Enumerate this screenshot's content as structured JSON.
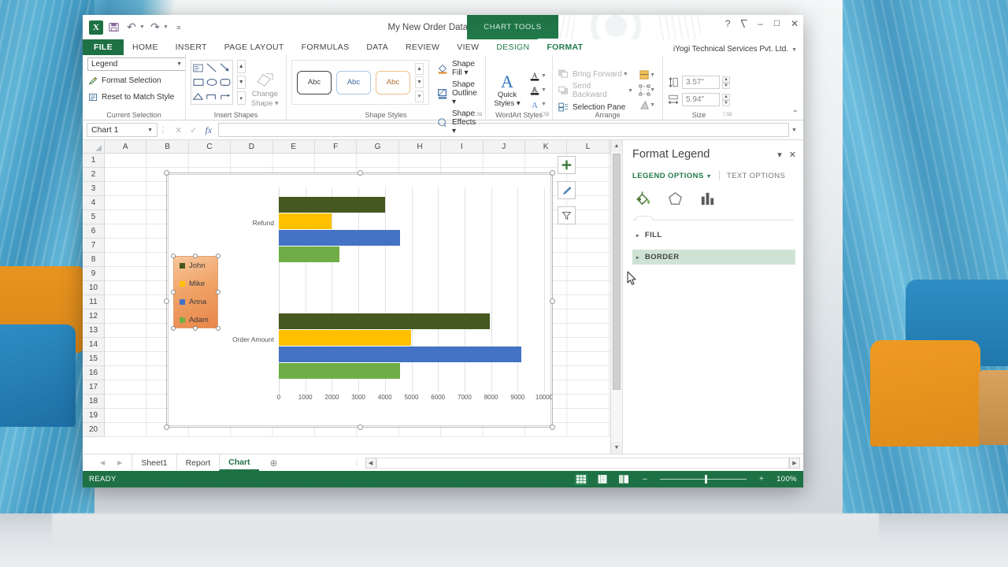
{
  "window": {
    "title": "My New Order Data - Excel",
    "contextual_tab_group": "CHART TOOLS",
    "account": "iYogi Technical Services Pvt. Ltd.",
    "help_icon": "?",
    "ribbon_display_icon": "ribbon-display-options",
    "minimize_icon": "–",
    "restore_icon": "❐",
    "close_icon": "✕",
    "logo_text": "X"
  },
  "quick_access": [
    {
      "name": "save-icon",
      "glyph": "ὋE"
    },
    {
      "name": "undo-icon",
      "glyph": "↶"
    },
    {
      "name": "redo-icon",
      "glyph": "↷"
    },
    {
      "name": "customize-qat-icon",
      "glyph": "≡"
    }
  ],
  "tabs": [
    {
      "label": "FILE",
      "kind": "file"
    },
    {
      "label": "HOME",
      "kind": "normal"
    },
    {
      "label": "INSERT",
      "kind": "normal"
    },
    {
      "label": "PAGE LAYOUT",
      "kind": "normal"
    },
    {
      "label": "FORMULAS",
      "kind": "normal"
    },
    {
      "label": "DATA",
      "kind": "normal"
    },
    {
      "label": "REVIEW",
      "kind": "normal"
    },
    {
      "label": "VIEW",
      "kind": "normal"
    },
    {
      "label": "DESIGN",
      "kind": "contextual"
    },
    {
      "label": "FORMAT",
      "kind": "contextual-active"
    }
  ],
  "ribbon": {
    "current_selection": {
      "group_label": "Current Selection",
      "combo_value": "Legend",
      "format_selection": "Format Selection",
      "reset_to_match_style": "Reset to Match Style"
    },
    "insert_shapes": {
      "group_label": "Insert Shapes",
      "change_shape_line1": "Change",
      "change_shape_line2": "Shape"
    },
    "shape_styles": {
      "group_label": "Shape Styles",
      "preview_text": "Abc",
      "shape_fill": "Shape Fill",
      "shape_outline": "Shape Outline",
      "shape_effects": "Shape Effects"
    },
    "wordart_styles": {
      "group_label": "WordArt Styles",
      "quick_line1": "Quick",
      "quick_line2": "Styles"
    },
    "arrange": {
      "group_label": "Arrange",
      "bring_forward": "Bring Forward",
      "send_backward": "Send Backward",
      "selection_pane": "Selection Pane"
    },
    "size": {
      "group_label": "Size",
      "height_value": "3.57\"",
      "width_value": "5.94\""
    },
    "collapse_icon": "⌃"
  },
  "formula_bar": {
    "name_box_value": "Chart 1",
    "cancel_icon": "✕",
    "enter_icon": "✓",
    "fx_icon": "fx",
    "formula_value": ""
  },
  "sheet": {
    "columns": [
      "A",
      "B",
      "C",
      "D",
      "E",
      "F",
      "G",
      "H",
      "I",
      "J",
      "K",
      "L"
    ],
    "rows": [
      1,
      2,
      3,
      4,
      5,
      6,
      7,
      8,
      9,
      10,
      11,
      12,
      13,
      14,
      15,
      16,
      17,
      18,
      19,
      20
    ]
  },
  "chart_buttons": [
    {
      "name": "chart-elements-button",
      "glyph": "✚"
    },
    {
      "name": "chart-styles-button",
      "glyph": "✐"
    },
    {
      "name": "chart-filters-button",
      "glyph": "▽"
    }
  ],
  "chart_data": {
    "type": "bar",
    "title": "",
    "xlabel": "",
    "ylabel": "",
    "categories": [
      "Refund",
      "Order Amount"
    ],
    "series": [
      {
        "name": "John",
        "color": "#44581f",
        "values": [
          4000,
          7950
        ]
      },
      {
        "name": "Mike",
        "color": "#ffc000",
        "values": [
          1980,
          4980
        ]
      },
      {
        "name": "Anna",
        "color": "#4472c4",
        "values": [
          4560,
          9150
        ]
      },
      {
        "name": "Adam",
        "color": "#70ad47",
        "values": [
          2280,
          4570
        ]
      }
    ],
    "xticks": [
      0,
      1000,
      2000,
      3000,
      4000,
      5000,
      6000,
      7000,
      8000,
      9000,
      10000
    ],
    "xlim": [
      0,
      10000
    ],
    "grid": true,
    "legend_position": "left",
    "legend_selected": true,
    "legend_fill": "orange-gradient",
    "orientation": "horizontal"
  },
  "pane": {
    "title": "Format Legend",
    "dropdown_icon": "▾",
    "close_icon": "✕",
    "tab_legend_options": "LEGEND OPTIONS",
    "tab_text_options": "TEXT OPTIONS",
    "icons": [
      {
        "name": "fill-and-line-icon"
      },
      {
        "name": "effects-icon"
      },
      {
        "name": "size-and-properties-icon"
      }
    ],
    "sections": [
      {
        "label": "FILL",
        "selected": false
      },
      {
        "label": "BORDER",
        "selected": true
      }
    ]
  },
  "sheet_tabs": {
    "prev_icon": "◀",
    "next_icon": "▶",
    "tabs": [
      {
        "label": "Sheet1",
        "active": false
      },
      {
        "label": "Report",
        "active": false
      },
      {
        "label": "Chart",
        "active": true
      }
    ],
    "new_sheet_icon": "⊕"
  },
  "status_bar": {
    "state": "READY",
    "views": [
      {
        "name": "normal-view-button",
        "glyph": "▦",
        "active": true
      },
      {
        "name": "page-layout-view-button",
        "glyph": "▤",
        "active": false
      },
      {
        "name": "page-break-preview-button",
        "glyph": "▥",
        "active": false
      }
    ],
    "zoom_out_icon": "–",
    "zoom_in_icon": "+",
    "zoom_level": "100%"
  },
  "colors": {
    "excel_green": "#1e7145",
    "accent_blue": "#4472c4",
    "selection_green": "#cfe3d4"
  }
}
